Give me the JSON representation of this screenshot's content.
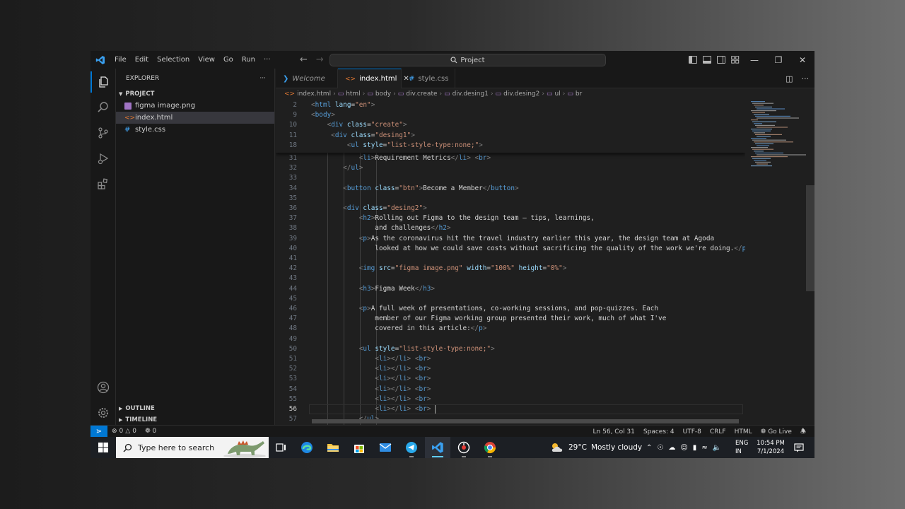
{
  "titlebar": {
    "menu": [
      "File",
      "Edit",
      "Selection",
      "View",
      "Go",
      "Run",
      "···"
    ],
    "search": "Project"
  },
  "sidebar": {
    "title": "EXPLORER",
    "more": "···",
    "project": "PROJECT",
    "files": [
      {
        "name": "figma image.png",
        "type": "image"
      },
      {
        "name": "index.html",
        "type": "html"
      },
      {
        "name": "style.css",
        "type": "css"
      }
    ],
    "outline": "OUTLINE",
    "timeline": "TIMELINE"
  },
  "tabs": [
    {
      "label": "Welcome",
      "icon": "vscode-icon"
    },
    {
      "label": "index.html",
      "icon": "html-icon"
    },
    {
      "label": "style.css",
      "icon": "css-icon"
    }
  ],
  "breadcrumb": [
    "index.html",
    "html",
    "body",
    "div.create",
    "div.desing1",
    "div.desing2",
    "ul",
    "br"
  ],
  "code": {
    "sticky": [
      {
        "n": "2",
        "t": "<html lang=\"en\">"
      },
      {
        "n": "9",
        "t": "<body>"
      },
      {
        "n": "10",
        "t": "    <div class=\"create\">"
      },
      {
        "n": "11",
        "t": "     <div class=\"desing1\">"
      },
      {
        "n": "18",
        "t": "         <ul style=\"list-style-type:none;\">"
      }
    ],
    "lines": [
      {
        "n": "31",
        "t": "            <li>Requirement Metrics</li> <br>"
      },
      {
        "n": "32",
        "t": "        </ul>"
      },
      {
        "n": "33",
        "t": ""
      },
      {
        "n": "34",
        "t": "        <button class=\"btn\">Become a Member</button>"
      },
      {
        "n": "35",
        "t": ""
      },
      {
        "n": "36",
        "t": "        <div class=\"desing2\">"
      },
      {
        "n": "37",
        "t": "            <h2>Rolling out Figma to the design team – tips, learnings,"
      },
      {
        "n": "38",
        "t": "                and challenges</h2>"
      },
      {
        "n": "39",
        "t": "            <p>As the coronavirus hit the travel industry earlier this year, the design team at Agoda"
      },
      {
        "n": "40",
        "t": "                looked at how we could save costs without sacrificing the quality of the work we're doing.</p>"
      },
      {
        "n": "41",
        "t": ""
      },
      {
        "n": "42",
        "t": "            <img src=\"figma image.png\" width=\"100%\" height=\"0%\">"
      },
      {
        "n": "43",
        "t": ""
      },
      {
        "n": "44",
        "t": "            <h3>Figma Week</h3>"
      },
      {
        "n": "45",
        "t": ""
      },
      {
        "n": "46",
        "t": "            <p>A full week of presentations, co-working sessions, and pop-quizzes. Each"
      },
      {
        "n": "47",
        "t": "                member of our Figma working group presented their work, much of what I've"
      },
      {
        "n": "48",
        "t": "                covered in this article:</p>"
      },
      {
        "n": "49",
        "t": ""
      },
      {
        "n": "50",
        "t": "            <ul style=\"list-style-type:none;\">"
      },
      {
        "n": "51",
        "t": "                <li></li> <br>"
      },
      {
        "n": "52",
        "t": "                <li></li> <br>"
      },
      {
        "n": "53",
        "t": "                <li></li> <br>"
      },
      {
        "n": "54",
        "t": "                <li></li> <br>"
      },
      {
        "n": "55",
        "t": "                <li></li> <br>"
      },
      {
        "n": "56",
        "t": "                <li></li> <br>"
      },
      {
        "n": "57",
        "t": "            </ul>"
      }
    ]
  },
  "statusbar": {
    "errors": "0",
    "warnings": "0",
    "ports": "0",
    "position": "Ln 56, Col 31",
    "spaces": "Spaces: 4",
    "encoding": "UTF-8",
    "eol": "CRLF",
    "language": "HTML",
    "golive": "Go Live"
  },
  "taskbar": {
    "search_placeholder": "Type here to search",
    "weather_temp": "29°C",
    "weather_desc": "Mostly cloudy",
    "lang1": "ENG",
    "lang2": "IN",
    "time": "10:54 PM",
    "date": "7/1/2024"
  },
  "colors": {
    "accent": "#0078d4",
    "tag": "#569cd6",
    "attribute": "#9cdcfe",
    "string": "#ce9178",
    "text": "#d4d4d4"
  }
}
